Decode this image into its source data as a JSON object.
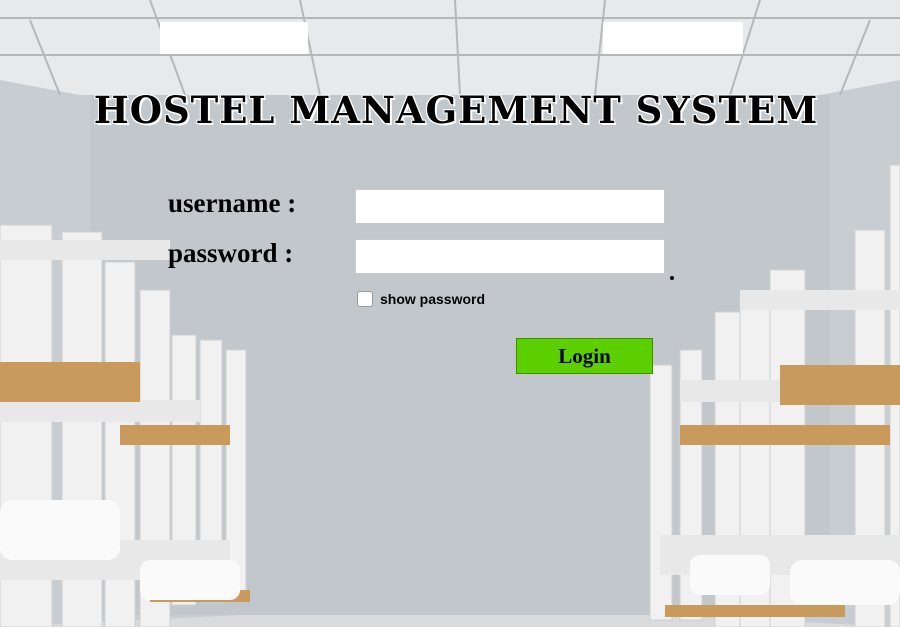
{
  "title": "HOSTEL MANAGEMENT SYSTEM",
  "form": {
    "username_label": "username :",
    "username_value": "",
    "password_label": "password :",
    "password_value": "",
    "show_password_label": "show password",
    "show_password_checked": false,
    "login_label": "Login"
  },
  "colors": {
    "login_button": "#5ccf00",
    "title_text": "#000000",
    "field_background": "#ffffff"
  },
  "background": {
    "scene": "hostel-dormitory-bunk-beds"
  }
}
